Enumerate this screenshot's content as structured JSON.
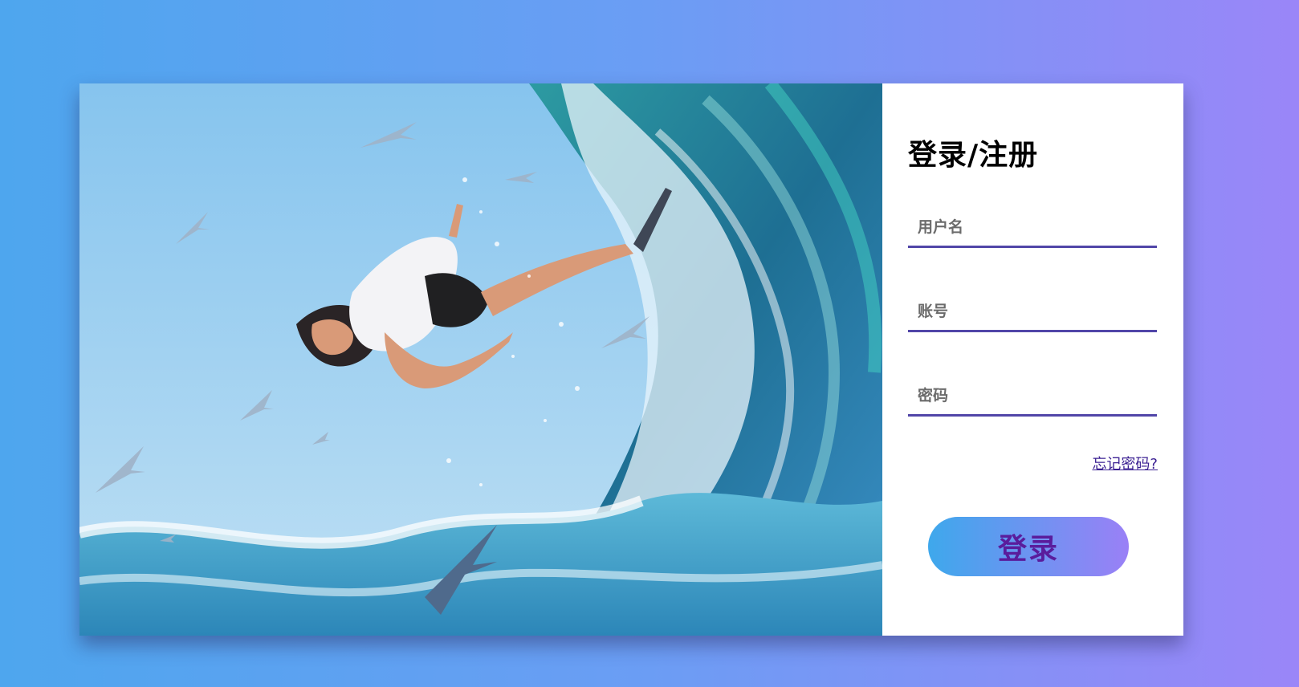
{
  "form": {
    "title": "登录/注册",
    "username_placeholder": "用户名",
    "account_placeholder": "账号",
    "password_placeholder": "密码",
    "forgot_link": "忘记密码?",
    "login_button": "登录"
  },
  "colors": {
    "background_gradient": [
      "#4ea6ee",
      "#9a86f8"
    ],
    "field_underline": "#5146a8",
    "button_gradient": [
      "#3ea8ec",
      "#9a80f6"
    ],
    "button_text": "#5a1c9c",
    "link": "#3a1f92"
  }
}
